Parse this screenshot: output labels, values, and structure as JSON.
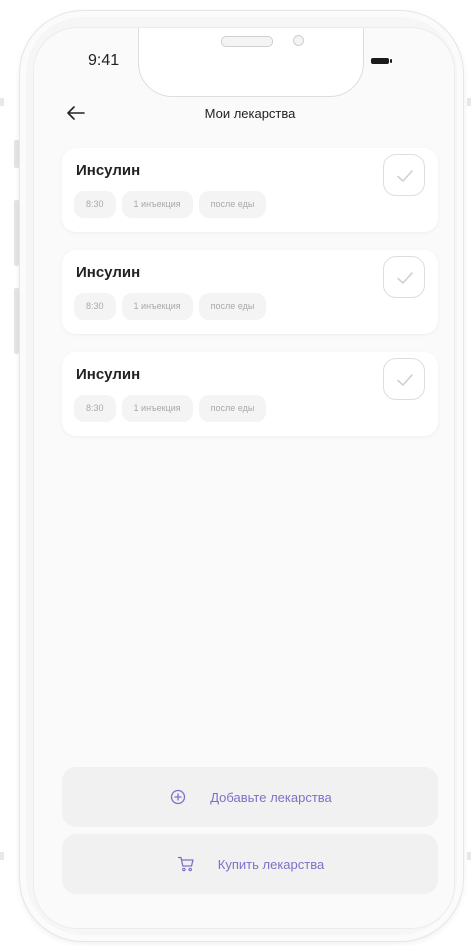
{
  "status_bar": {
    "time": "9:41"
  },
  "header": {
    "back_icon": "arrow-left-icon",
    "title": "Мои лекарства"
  },
  "medications": [
    {
      "name": "Инсулин",
      "time": "8:30",
      "dose": "1 инъекция",
      "timing": "после еды",
      "check_icon": "check-icon"
    },
    {
      "name": "Инсулин",
      "time": "8:30",
      "dose": "1 инъекция",
      "timing": "после еды",
      "check_icon": "check-icon"
    },
    {
      "name": "Инсулин",
      "time": "8:30",
      "dose": "1 инъекция",
      "timing": "после еды",
      "check_icon": "check-icon"
    }
  ],
  "actions": {
    "add_label": "Добавьте лекарства",
    "add_icon": "plus-circle-icon",
    "buy_label": "Купить лекарства",
    "buy_icon": "cart-icon"
  },
  "colors": {
    "accent": "#7b72c8",
    "chip_bg": "#f4f4f4",
    "chip_text": "#a9a9a9",
    "action_bg": "#f1f1f1"
  }
}
